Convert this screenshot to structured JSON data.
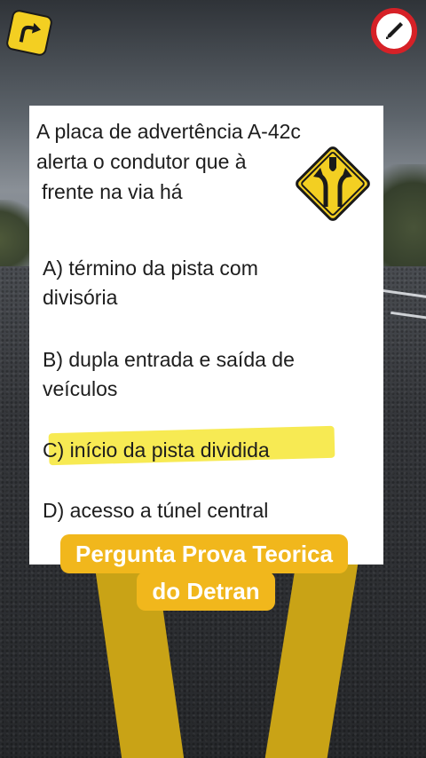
{
  "question": {
    "line1": "A placa de advertência A-42c",
    "line2": "alerta o condutor que à",
    "line3": "frente na via há"
  },
  "options": [
    {
      "label": "A) término da pista com",
      "label2": "divisória"
    },
    {
      "label": "B) dupla entrada e saída de",
      "label2": "veículos"
    },
    {
      "label": "C) início da pista dividida",
      "highlighted": true
    },
    {
      "label": "D) acesso a túnel central"
    }
  ],
  "caption": {
    "line1": "Pergunta Prova Teorica",
    "line2": "do Detran"
  },
  "icons": {
    "top_left": "road-curve-sign-icon",
    "top_right": "edit-pencil-icon",
    "question_sign": "divided-road-warning-sign-icon"
  },
  "colors": {
    "highlight": "#f7e94a",
    "caption_bg": "#f1b71c",
    "sign_yellow": "#f3cf22",
    "sign_red": "#d62127"
  }
}
